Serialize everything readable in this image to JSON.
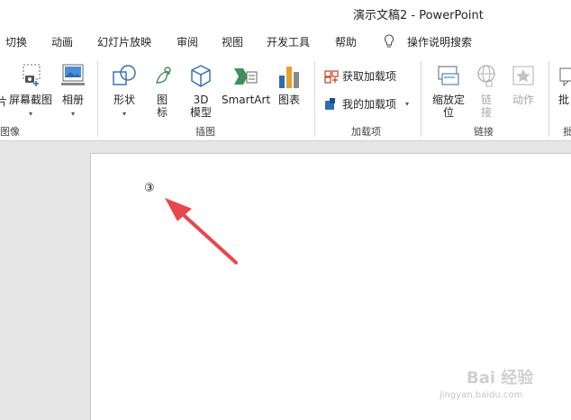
{
  "window": {
    "title": "演示文稿2  -  PowerPoint"
  },
  "tabs": [
    {
      "label": "切换"
    },
    {
      "label": "动画"
    },
    {
      "label": "幻灯片放映"
    },
    {
      "label": "审阅"
    },
    {
      "label": "视图"
    },
    {
      "label": "开发工具"
    },
    {
      "label": "帮助"
    },
    {
      "label": "操作说明搜索"
    }
  ],
  "ribbon": {
    "images_group": {
      "label": "图像",
      "partial_label": "片",
      "screenshot": "屏幕截图",
      "album": "相册"
    },
    "illustrations_group": {
      "label": "插图",
      "shapes": "形状",
      "icons_line1": "图",
      "icons_line2": "标",
      "model_line1": "3D",
      "model_line2": "模型",
      "smartart": "SmartArt",
      "chart": "图表"
    },
    "addins_group": {
      "label": "加载项",
      "get_addins": "获取加载项",
      "my_addins": "我的加载项"
    },
    "links_group": {
      "label": "链接",
      "zoom_line1": "缩放定",
      "zoom_line2": "位",
      "link_line1": "链",
      "link_line2": "接",
      "action": "动作"
    },
    "partial_group": {
      "label": "批",
      "button": "批"
    }
  },
  "slide": {
    "marker": "③"
  },
  "watermark": {
    "brand": "Bai 经验",
    "url": "jingyan.baidu.com"
  },
  "colors": {
    "arrow": "#e8474c",
    "accent": "#c43e1c",
    "icon_blue": "#2b6cb5"
  }
}
